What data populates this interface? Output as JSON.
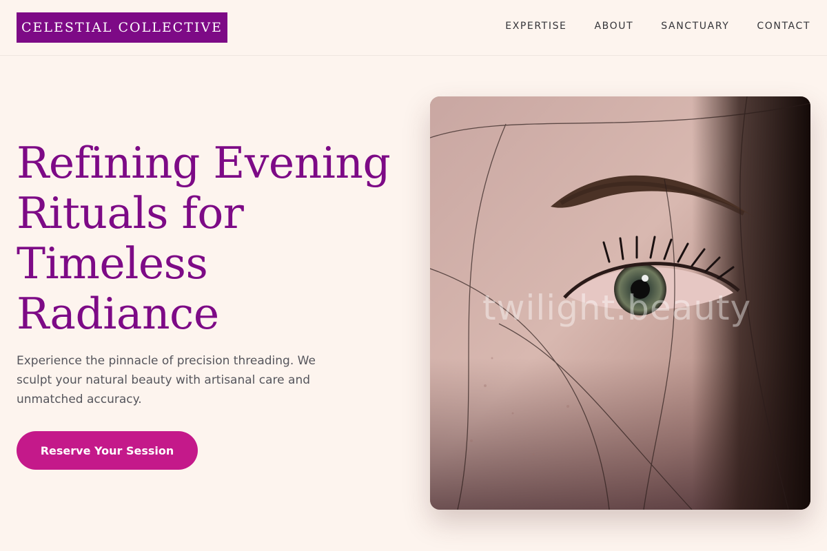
{
  "brand": {
    "name": "CELESTIAL COLLECTIVE",
    "color": "#7d0a86"
  },
  "nav": {
    "items": [
      {
        "label": "EXPERTISE"
      },
      {
        "label": "ABOUT"
      },
      {
        "label": "SANCTUARY"
      },
      {
        "label": "CONTACT"
      }
    ]
  },
  "hero": {
    "headline": "Refining Evening Rituals for Timeless Radiance",
    "description": "Experience the pinnacle of precision threading. We sculpt your natural beauty with artisanal care and unmatched accuracy.",
    "cta_label": "Reserve Your Session",
    "cta_color": "#c4198a"
  },
  "image": {
    "subject": "close-up of woman's eye and eyebrow",
    "watermark": "twilight.beauty"
  },
  "colors": {
    "background": "#fdf4ee",
    "headline": "#7d0a86",
    "body_text": "#55555c"
  }
}
